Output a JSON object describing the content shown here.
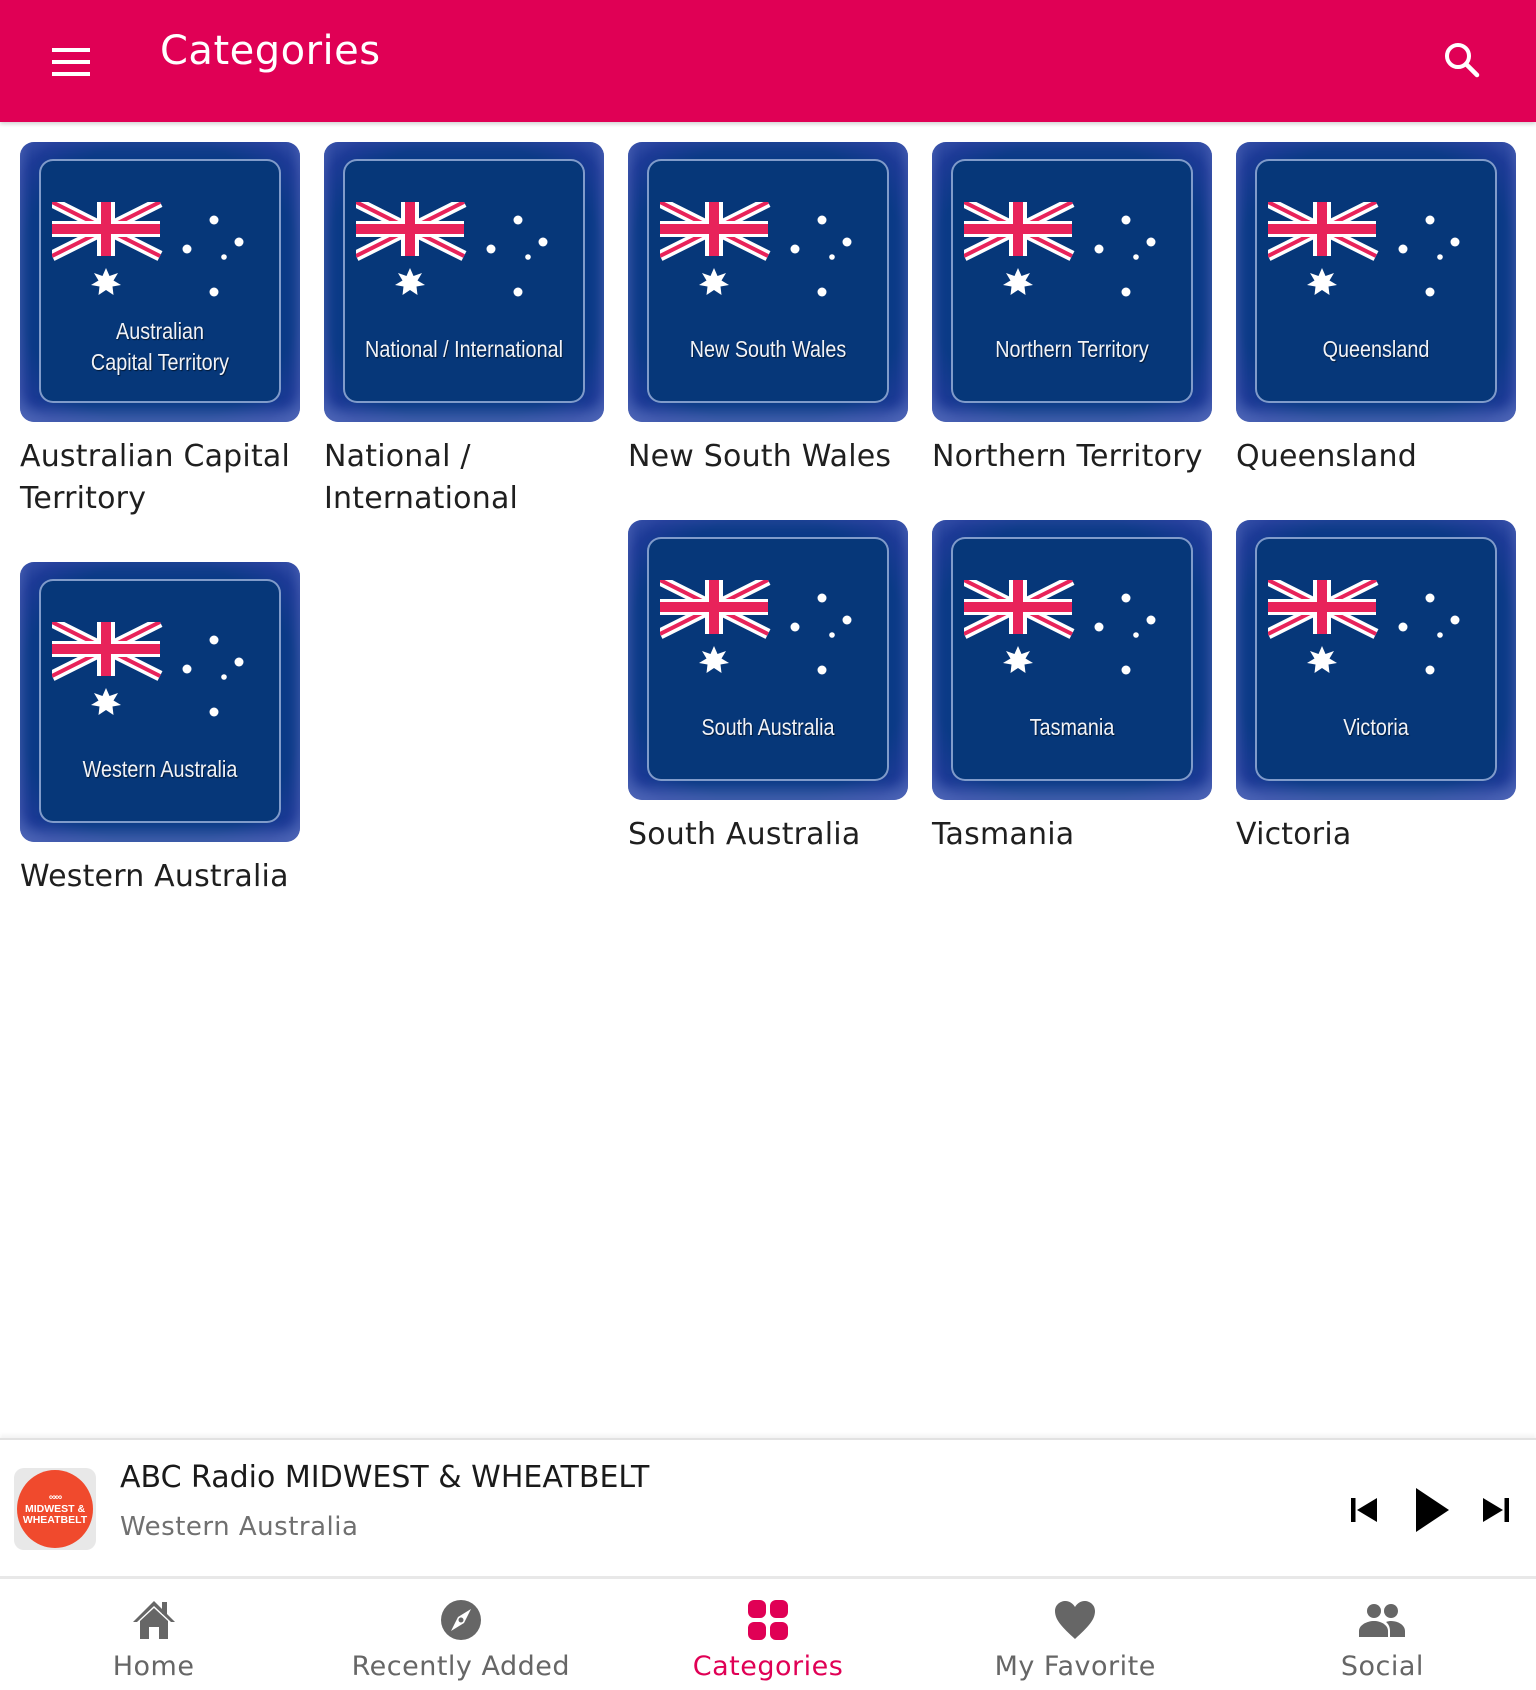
{
  "appbar": {
    "title": "Categories",
    "menu_icon": "hamburger-menu-icon",
    "search_icon": "search-icon",
    "color": "#e00055"
  },
  "categories": [
    {
      "label": "Australian Capital Territory",
      "tile_text": "Australian\nCapital Territory",
      "icon": "australian-flag-image"
    },
    {
      "label": "National / International",
      "tile_text": "National / International",
      "icon": "australian-flag-image"
    },
    {
      "label": "New South Wales",
      "tile_text": "New South Wales",
      "icon": "australian-flag-image"
    },
    {
      "label": "Northern Territory",
      "tile_text": "Northern Territory",
      "icon": "australian-flag-image"
    },
    {
      "label": "Queensland",
      "tile_text": "Queensland",
      "icon": "australian-flag-image"
    },
    {
      "label": "Western Australia",
      "tile_text": "Western Australia",
      "icon": "australian-flag-image"
    },
    {
      "label": "South Australia",
      "tile_text": "South Australia",
      "icon": "australian-flag-image"
    },
    {
      "label": "Tasmania",
      "tile_text": "Tasmania",
      "icon": "australian-flag-image"
    },
    {
      "label": "Victoria",
      "tile_text": "Victoria",
      "icon": "australian-flag-image"
    }
  ],
  "player": {
    "station": "ABC Radio MIDWEST & WHEATBELT",
    "region": "Western Australia",
    "artwork": {
      "logo_text": "ABC",
      "line1": "MIDWEST &",
      "line2": "WHEATBELT",
      "color": "#f04a2d"
    },
    "controls": [
      "skip-previous-icon",
      "play-icon",
      "skip-next-icon"
    ]
  },
  "bottom_nav": {
    "active_color": "#e00055",
    "inactive_color": "#666666",
    "items": [
      {
        "label": "Home",
        "icon": "home-icon",
        "active": false
      },
      {
        "label": "Recently Added",
        "icon": "compass-icon",
        "active": false
      },
      {
        "label": "Categories",
        "icon": "categories-grid-icon",
        "active": true
      },
      {
        "label": "My Favorite",
        "icon": "heart-icon",
        "active": false
      },
      {
        "label": "Social",
        "icon": "people-icon",
        "active": false
      }
    ]
  }
}
